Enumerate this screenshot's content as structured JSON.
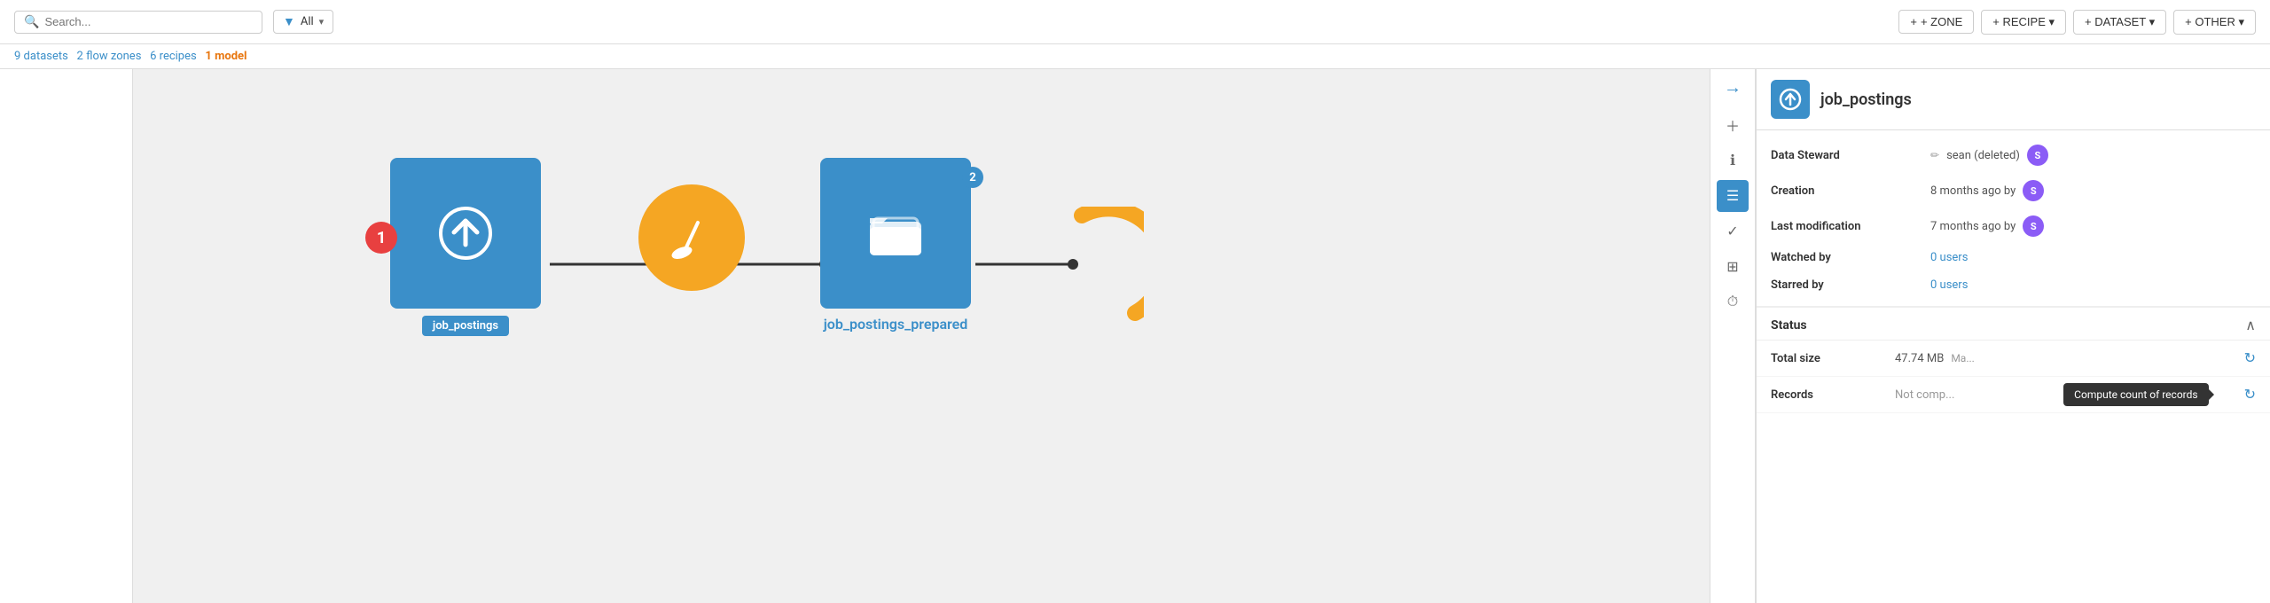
{
  "toolbar": {
    "search_placeholder": "Search...",
    "filter_label": "All",
    "buttons": [
      {
        "id": "zone",
        "label": "+ ZONE"
      },
      {
        "id": "recipe",
        "label": "+ RECIPE ▾"
      },
      {
        "id": "dataset",
        "label": "+ DATASET ▾"
      },
      {
        "id": "other",
        "label": "+ OTHER ▾"
      }
    ]
  },
  "breadcrumb": {
    "datasets_count": "9",
    "datasets_label": "datasets",
    "flow_zones_count": "2",
    "flow_zones_label": "flow zones",
    "recipes_count": "6",
    "recipes_label": "recipes",
    "model_count": "1",
    "model_label": "model"
  },
  "flow": {
    "node1": {
      "label": "job_postings",
      "badge": "1"
    },
    "node2": {
      "label": "job_postings_prepared",
      "badge": "2"
    }
  },
  "right_panel": {
    "title": "job_postings",
    "icon_label": "↑",
    "rows": {
      "data_steward": {
        "label": "Data Steward",
        "value": "sean (deleted)",
        "avatar": "S"
      },
      "creation": {
        "label": "Creation",
        "value": "8 months ago by",
        "avatar": "S"
      },
      "last_modification": {
        "label": "Last modification",
        "value": "7 months ago by",
        "avatar": "S"
      },
      "watched_by": {
        "label": "Watched by",
        "value": "0 users"
      },
      "starred_by": {
        "label": "Starred by",
        "value": "0 users"
      }
    },
    "status": {
      "title": "Status",
      "total_size": {
        "label": "Total size",
        "value": "47.74 MB"
      },
      "records": {
        "label": "Records",
        "value": "Not comp..."
      }
    },
    "tooltip": "Compute count of records"
  }
}
